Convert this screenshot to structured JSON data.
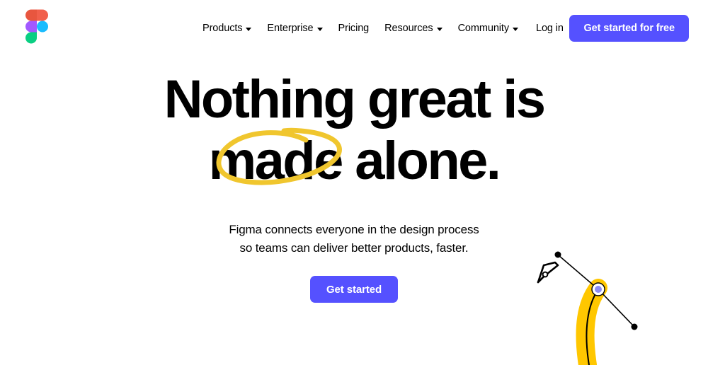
{
  "brand": {
    "logo_name": "figma-logo",
    "logo_colors": {
      "red": "#E8563F",
      "orange": "#E8563F",
      "purple": "#A259FF",
      "blue": "#1ABCFE",
      "green": "#0ACF83"
    }
  },
  "colors": {
    "accent_purple": "#5551FF",
    "highlight_yellow": "#F0C62E",
    "illustration_yellow": "#FFC700",
    "text_black": "#000000",
    "page_background": "#FFFFFF",
    "anchor_blue": "#8C8CF5"
  },
  "nav": {
    "items": [
      {
        "label": "Products",
        "has_caret": true,
        "icon": "chevron-down-icon"
      },
      {
        "label": "Enterprise",
        "has_caret": true,
        "icon": "chevron-down-icon"
      },
      {
        "label": "Pricing",
        "has_caret": false,
        "icon": ""
      },
      {
        "label": "Resources",
        "has_caret": true,
        "icon": "chevron-down-icon"
      },
      {
        "label": "Community",
        "has_caret": true,
        "icon": "chevron-down-icon"
      },
      {
        "label": "Log in",
        "has_caret": false,
        "icon": ""
      }
    ],
    "cta_label": "Get started for free"
  },
  "hero": {
    "headline_line1": "Nothing great is",
    "headline_line2": "made alone.",
    "highlighted_word": "made",
    "annotation": "hand-drawn-yellow-ellipse",
    "subhead_line1": "Figma connects everyone in the design process",
    "subhead_line2": "so teams can deliver better products, faster.",
    "cta_label": "Get started"
  },
  "illustration": {
    "name": "pen-tool-bezier-curve",
    "elements": [
      "pen-tool-cursor-icon",
      "bezier-handle-line",
      "handle-endpoint-dot-top",
      "anchor-point-circle",
      "handle-endpoint-dot-bottom",
      "yellow-vector-stroke"
    ]
  }
}
